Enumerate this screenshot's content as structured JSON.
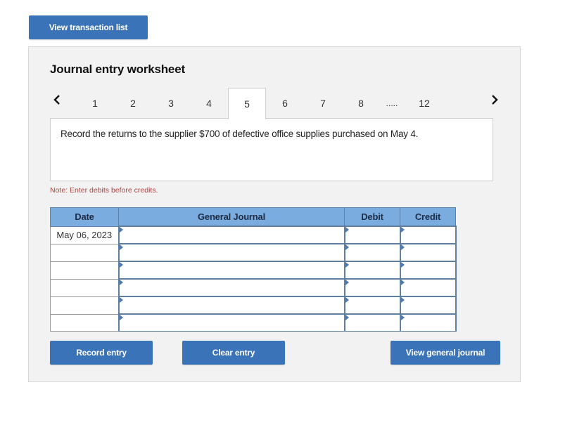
{
  "top_button": {
    "label": "View transaction list"
  },
  "worksheet": {
    "title": "Journal entry worksheet",
    "prev_icon": "chevron-left-icon",
    "next_icon": "chevron-right-icon",
    "tabs": [
      {
        "label": "1"
      },
      {
        "label": "2"
      },
      {
        "label": "3"
      },
      {
        "label": "4"
      },
      {
        "label": "5",
        "active": true
      },
      {
        "label": "6"
      },
      {
        "label": "7"
      },
      {
        "label": "8"
      },
      {
        "label": "....."
      },
      {
        "label": "12"
      }
    ],
    "description": "Record the returns to the supplier $700 of defective office supplies purchased on May 4.",
    "note": "Note: Enter debits before credits.",
    "table": {
      "headers": {
        "date": "Date",
        "general_journal": "General Journal",
        "debit": "Debit",
        "credit": "Credit"
      },
      "rows": [
        {
          "date": "May 06, 2023",
          "account": "",
          "debit": "",
          "credit": ""
        },
        {
          "date": "",
          "account": "",
          "debit": "",
          "credit": ""
        },
        {
          "date": "",
          "account": "",
          "debit": "",
          "credit": ""
        },
        {
          "date": "",
          "account": "",
          "debit": "",
          "credit": ""
        },
        {
          "date": "",
          "account": "",
          "debit": "",
          "credit": ""
        },
        {
          "date": "",
          "account": "",
          "debit": "",
          "credit": ""
        }
      ]
    },
    "buttons": {
      "record": "Record entry",
      "clear": "Clear entry",
      "view_journal": "View general journal"
    }
  },
  "colors": {
    "button_bg": "#3a73b7",
    "table_header_bg": "#7aace0",
    "note_text": "#a94442",
    "panel_bg": "#f2f2f2"
  }
}
